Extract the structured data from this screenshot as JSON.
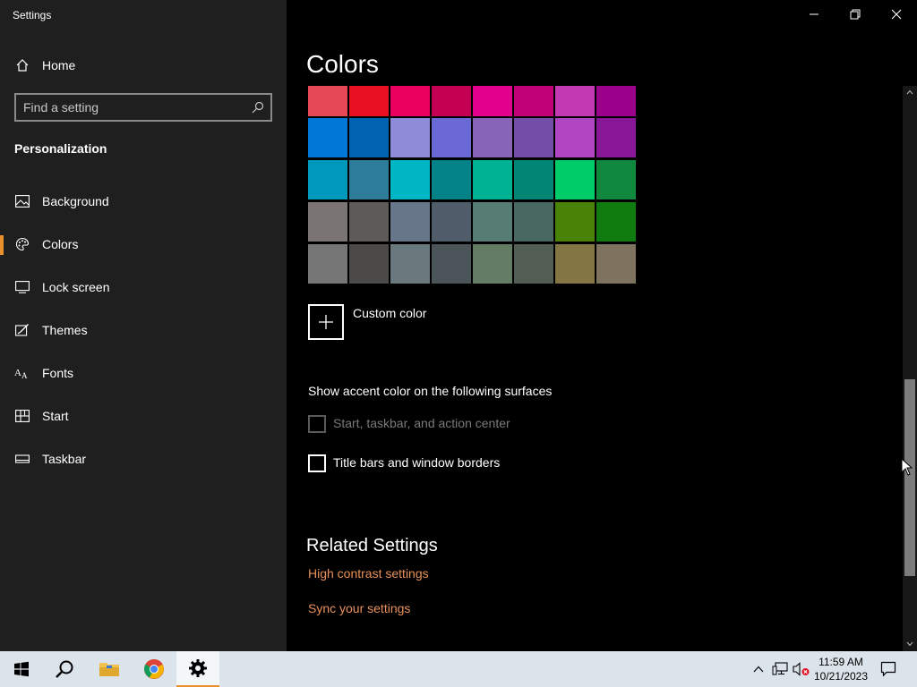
{
  "window": {
    "app_title": "Settings"
  },
  "sidebar": {
    "home_label": "Home",
    "search_placeholder": "Find a setting",
    "section_label": "Personalization",
    "items": [
      {
        "label": "Background",
        "icon": "image-icon"
      },
      {
        "label": "Colors",
        "icon": "palette-icon",
        "active": true
      },
      {
        "label": "Lock screen",
        "icon": "lock-screen-icon"
      },
      {
        "label": "Themes",
        "icon": "themes-icon"
      },
      {
        "label": "Fonts",
        "icon": "fonts-icon"
      },
      {
        "label": "Start",
        "icon": "start-icon"
      },
      {
        "label": "Taskbar",
        "icon": "taskbar-icon"
      }
    ],
    "accent_color": "#e8912d"
  },
  "main": {
    "title": "Colors",
    "swatches": [
      [
        "#e74856",
        "#e81123",
        "#ea005e",
        "#c30052",
        "#e3008c",
        "#bf0077",
        "#c239b3",
        "#9a0089"
      ],
      [
        "#0078d7",
        "#0063b1",
        "#8e8cd8",
        "#6b69d6",
        "#8764b8",
        "#744da9",
        "#b146c2",
        "#881798"
      ],
      [
        "#0099bc",
        "#2d7d9a",
        "#00b7c3",
        "#038387",
        "#00b294",
        "#018574",
        "#00cc6a",
        "#10893e"
      ],
      [
        "#7a7574",
        "#5d5a58",
        "#68768a",
        "#515c6b",
        "#567c73",
        "#486860",
        "#498205",
        "#107c10"
      ],
      [
        "#767676",
        "#4c4a48",
        "#69797e",
        "#4a5459",
        "#647c64",
        "#525e54",
        "#847545",
        "#7e735f"
      ]
    ],
    "custom_color_label": "Custom color",
    "accent_surfaces_heading": "Show accent color on the following surfaces",
    "checkbox_start_taskbar": "Start, taskbar, and action center",
    "checkbox_title_bars": "Title bars and window borders",
    "related_heading": "Related Settings",
    "link_high_contrast": "High contrast settings",
    "link_sync": "Sync your settings"
  },
  "taskbar": {
    "time": "11:59 AM",
    "date": "10/21/2023"
  }
}
